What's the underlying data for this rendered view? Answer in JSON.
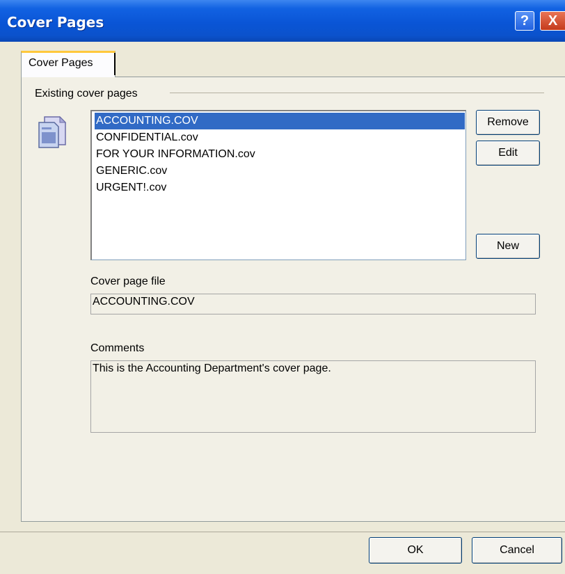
{
  "window": {
    "title": "Cover Pages",
    "help_glyph": "?",
    "close_glyph": "X"
  },
  "tabs": [
    {
      "label": "Cover Pages",
      "active": true
    }
  ],
  "existing": {
    "group_label": "Existing cover pages",
    "icon": "document-icon",
    "items": [
      "ACCOUNTING.COV",
      "CONFIDENTIAL.cov",
      "FOR YOUR INFORMATION.cov",
      "GENERIC.cov",
      "URGENT!.cov"
    ],
    "selected_index": 0
  },
  "buttons": {
    "remove": "Remove",
    "edit": "Edit",
    "new": "New",
    "ok": "OK",
    "cancel": "Cancel"
  },
  "cover_page_file": {
    "label": "Cover page file",
    "value": "ACCOUNTING.COV"
  },
  "comments": {
    "label": "Comments",
    "value": "This is the Accounting Department's cover page."
  },
  "colors": {
    "titlebar": "#0A55D6",
    "selection": "#316AC5",
    "dialog_bg": "#ECE9D8"
  }
}
